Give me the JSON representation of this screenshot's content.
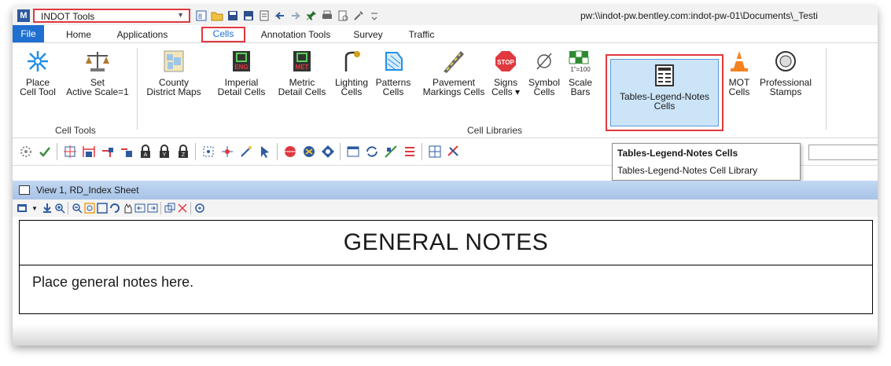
{
  "quick_access": {
    "workspace_value": "INDOT Tools",
    "path": "pw:\\\\indot-pw.bentley.com:indot-pw-01\\Documents\\_Testi"
  },
  "tabs": [
    {
      "label": "File"
    },
    {
      "label": "Home"
    },
    {
      "label": "Applications"
    },
    {
      "label": "Cells"
    },
    {
      "label": "Annotation Tools"
    },
    {
      "label": "Survey"
    },
    {
      "label": "Traffic"
    }
  ],
  "ribbon": {
    "buttons": [
      {
        "label": "Place\nCell Tool",
        "icon": "place-cell-icon"
      },
      {
        "label": "Set\nActive Scale=1",
        "icon": "scale-icon"
      },
      {
        "label": "County\nDistrict Maps",
        "icon": "county-map-icon"
      },
      {
        "label": "Imperial\nDetail Cells",
        "icon": "eng-detail-icon",
        "badge": "ENG"
      },
      {
        "label": "Metric\nDetail Cells",
        "icon": "met-detail-icon",
        "badge": "MET"
      },
      {
        "label": "Lighting\nCells",
        "icon": "lighting-icon"
      },
      {
        "label": "Patterns\nCells",
        "icon": "patterns-icon"
      },
      {
        "label": "Pavement\nMarkings Cells",
        "icon": "pavement-icon"
      },
      {
        "label": "Signs\nCells ▾",
        "icon": "stop-sign-icon",
        "badge": "STOP"
      },
      {
        "label": "Symbol\nCells",
        "icon": "symbol-icon"
      },
      {
        "label": "Scale\nBars",
        "icon": "scale-bar-icon",
        "badge": "1\"=100"
      },
      {
        "label": "Tables-Legend-Notes\nCells",
        "icon": "table-notes-icon"
      },
      {
        "label": "MOT\nCells",
        "icon": "traffic-cone-icon"
      },
      {
        "label": "Professional\nStamps",
        "icon": "stamp-icon"
      }
    ],
    "groups": [
      {
        "label": "Cell Tools"
      },
      {
        "label": "Cell Libraries"
      }
    ]
  },
  "tooltip": {
    "title": "Tables-Legend-Notes Cells",
    "description": "Tables-Legend-Notes Cell Library"
  },
  "view": {
    "title": "View 1, RD_Index Sheet"
  },
  "sheet": {
    "heading": "GENERAL NOTES",
    "body": "Place general notes here."
  },
  "colors": {
    "highlight": "#e0383e",
    "accent": "#1f6fd0",
    "view_bar": "#b4cdea"
  }
}
